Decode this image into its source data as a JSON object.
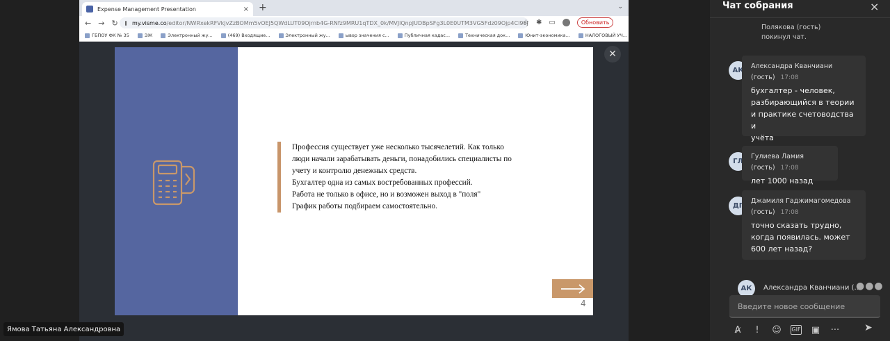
{
  "browser": {
    "tab_title": "Expense Management Presentation",
    "tab_close": "×",
    "new_tab": "+",
    "tab_chevron": "⌄",
    "url_host": "my.visme.co",
    "url_path": "/editor/NWRxekRFVkJvZzBOMm5vOEJ5QWdLUT09Ojrnb4G-RNfz9MRU1qTDX_0k/MVJlQnpJUDBpSFg3L0E0UTM3VG5Fdz09Ojp4Cl96JJl...",
    "update_label": "Обновить",
    "bookmarks": [
      "ГБПОУ ФК № 35",
      "ЭЖ",
      "Электронный жу...",
      "(469) Входящие...",
      "Электронный жу...",
      "ывор значения с...",
      "Публичная кадас...",
      "Техническая док...",
      "Юнит-экономика...",
      "НАЛОГОВЫЙ УЧ..."
    ],
    "bookmarks_more": "»"
  },
  "slide": {
    "lines": [
      "Профессия существует уже несколько тысячелетий. Как только",
      "люди начали зарабатывать деньги, понадобились специалисты по",
      "учету и контролю денежных средств.",
      "Бухгалтер одна из самых востребованных профессий.",
      "Работа не только в офисе, но и возможен выход в \"поля\"",
      "График работы подбираем самостоятельно."
    ],
    "page_number": "4",
    "accent": "#c9986a",
    "left_panel": "#5566a0"
  },
  "presenter_name": "Ямова Татьяна Александровна",
  "chat": {
    "title": "Чат собрания",
    "close": "×",
    "system_message": [
      "Полякова (гость)",
      "покинул чат."
    ],
    "messages": [
      {
        "initials": "АК",
        "author": "Александра Кванчиани",
        "author2": "(гость)",
        "time": "17:08",
        "lines": [
          "бухгалтер - человек,",
          "разбирающийся в теории",
          "и практике счетоводства и",
          "учёта"
        ]
      },
      {
        "initials": "ГЛ",
        "author": "Гулиева Ламия (гость)",
        "author2": "",
        "time": "17:08",
        "lines": [
          "лет 1000 назад"
        ]
      },
      {
        "initials": "ДГ",
        "author": "Джамиля Гаджимагомедова",
        "author2": "(гость)",
        "time": "17:08",
        "lines": [
          "точно сказать трудно,",
          "когда появилась. может",
          "600 лет назад?"
        ]
      }
    ],
    "last_initials": "АК",
    "last_preview": "Александра Кванчиани (...",
    "last_dots": "●●●",
    "composer_placeholder": "Введите новое сообщение"
  }
}
